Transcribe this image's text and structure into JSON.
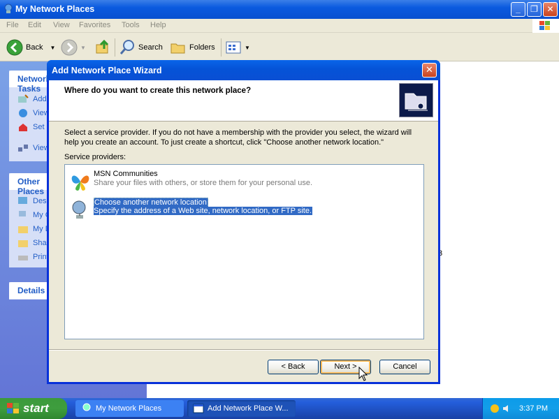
{
  "main_window": {
    "title": "My Network Places",
    "menu": [
      "File",
      "Edit",
      "View",
      "Favorites",
      "Tools",
      "Help"
    ],
    "toolbar": {
      "back": "Back",
      "search": "Search",
      "folders": "Folders"
    }
  },
  "taskpane": {
    "network_tasks_head": "Network Tasks",
    "network_tasks": [
      "Add a network place",
      "View network connections",
      "Set up a home or small office network",
      "View workgroup computers"
    ],
    "other_places_head": "Other Places",
    "other_places": [
      "Desktop",
      "My Computer",
      "My Documents",
      "Shared Documents",
      "Printers and Faxes"
    ],
    "details_head": "Details"
  },
  "stray_glyph": "3",
  "dialog": {
    "title": "Add Network Place Wizard",
    "close": "✕",
    "question": "Where do you want to create this network place?",
    "description": "Select a service provider.  If you do not have a membership with the provider you select, the wizard will help you create an account.  To just create a shortcut, click \"Choose another network location.\"",
    "providers_label": "Service providers:",
    "providers": [
      {
        "name": "MSN Communities",
        "desc": "Share your files with others, or store them for your personal use."
      },
      {
        "name": "Choose another network location",
        "desc": "Specify the address of a Web site, network location, or FTP site."
      }
    ],
    "buttons": {
      "back": "< Back",
      "next": "Next >",
      "cancel": "Cancel"
    }
  },
  "taskbar": {
    "start": "start",
    "tasks": [
      "My Network Places",
      "Add Network Place W..."
    ],
    "clock": "3:37 PM"
  }
}
